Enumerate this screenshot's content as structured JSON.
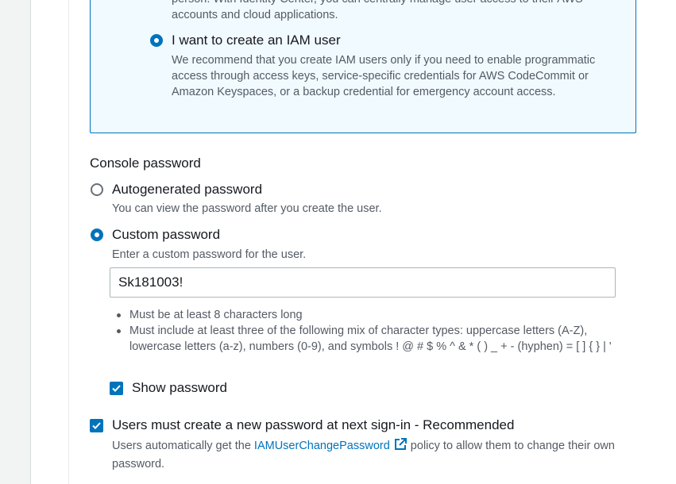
{
  "iam_option": {
    "clipped_text_line1": "person. With Identity Center, you can centrally manage user access to their AWS",
    "clipped_text_line2": "accounts and cloud applications.",
    "label": "I want to create an IAM user",
    "description": "We recommend that you create IAM users only if you need to enable programmatic access through access keys, service-specific credentials for AWS CodeCommit or Amazon Keyspaces, or a backup credential for emergency account access.",
    "selected": true
  },
  "console_password": {
    "title": "Console password",
    "autogenerated": {
      "label": "Autogenerated password",
      "description": "You can view the password after you create the user.",
      "selected": false
    },
    "custom": {
      "label": "Custom password",
      "description": "Enter a custom password for the user.",
      "selected": true,
      "value": "Sk181003!"
    },
    "rules": [
      "Must be at least 8 characters long",
      "Must include at least three of the following mix of character types: uppercase letters (A-Z), lowercase letters (a-z), numbers (0-9), and symbols ! @ # $ % ^ & * ( ) _ + - (hyphen) = [ ] { } | '"
    ],
    "show_password": {
      "label": "Show password",
      "checked": true
    }
  },
  "reset_option": {
    "label": "Users must create a new password at next sign-in - Recommended",
    "checked": true,
    "description_prefix": "Users automatically get the ",
    "link_text": "IAMUserChangePassword",
    "description_suffix": " policy to allow them to change their own password."
  },
  "colors": {
    "accent": "#0073bb",
    "selected_box_bg": "#f1faff",
    "secondary_text": "#545b64"
  }
}
